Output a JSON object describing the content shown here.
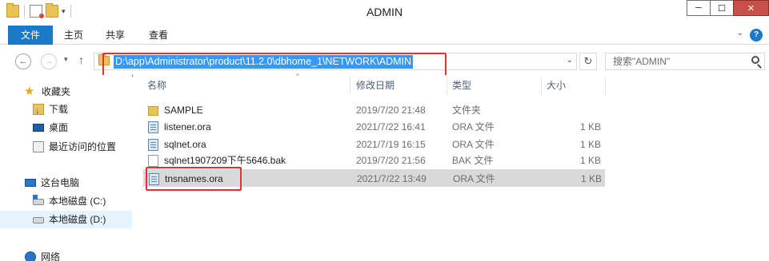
{
  "window": {
    "title": "ADMIN",
    "buttons": {
      "minimize": "─",
      "maximize": "☐",
      "close": "✕"
    }
  },
  "ribbon": {
    "tabs": [
      {
        "label": "文件",
        "active": true
      },
      {
        "label": "主页"
      },
      {
        "label": "共享"
      },
      {
        "label": "查看"
      }
    ],
    "collapse_glyph": "⌄",
    "help_glyph": "?"
  },
  "navbar": {
    "back_glyph": "←",
    "forward_glyph": "→",
    "recent_glyph": "▾",
    "up_glyph": "↑",
    "address": "D:\\app\\Administrator\\product\\11.2.0\\dbhome_1\\NETWORK\\ADMIN",
    "refresh_glyph": "↻",
    "search_placeholder": "搜索\"ADMIN\""
  },
  "sidebar": {
    "items": [
      {
        "label": "收藏夹",
        "icon": "star-icon"
      },
      {
        "label": "下载",
        "icon": "downloads-icon"
      },
      {
        "label": "桌面",
        "icon": "desktop-icon"
      },
      {
        "label": "最近访问的位置",
        "icon": "recent-places-icon"
      },
      {
        "label": "这台电脑",
        "icon": "this-pc-icon"
      },
      {
        "label": "本地磁盘 (C:)",
        "icon": "drive-icon"
      },
      {
        "label": "本地磁盘 (D:)",
        "icon": "drive-icon",
        "selected": true
      },
      {
        "label": "网络",
        "icon": "network-icon"
      }
    ]
  },
  "filelist": {
    "columns": {
      "name": "名称",
      "date": "修改日期",
      "type": "类型",
      "size": "大小"
    },
    "rows": [
      {
        "name": "SAMPLE",
        "date": "2019/7/20 21:48",
        "type": "文件夹",
        "size": "",
        "icon": "folder-icon"
      },
      {
        "name": "listener.ora",
        "date": "2021/7/22 16:41",
        "type": "ORA 文件",
        "size": "1 KB",
        "icon": "ora-file-icon"
      },
      {
        "name": "sqlnet.ora",
        "date": "2021/7/19 16:15",
        "type": "ORA 文件",
        "size": "1 KB",
        "icon": "ora-file-icon"
      },
      {
        "name": "sqlnet1907209下午5646.bak",
        "date": "2019/7/20 21:56",
        "type": "BAK 文件",
        "size": "1 KB",
        "icon": "bak-file-icon"
      },
      {
        "name": "tnsnames.ora",
        "date": "2021/7/22 13:49",
        "type": "ORA 文件",
        "size": "1 KB",
        "icon": "ora-file-icon",
        "selected": true
      }
    ]
  },
  "colors": {
    "accent": "#1979ca",
    "selection_highlight": "#3399ff",
    "annotation_red": "#e8312f",
    "row_selected": "#d9d9d9"
  }
}
